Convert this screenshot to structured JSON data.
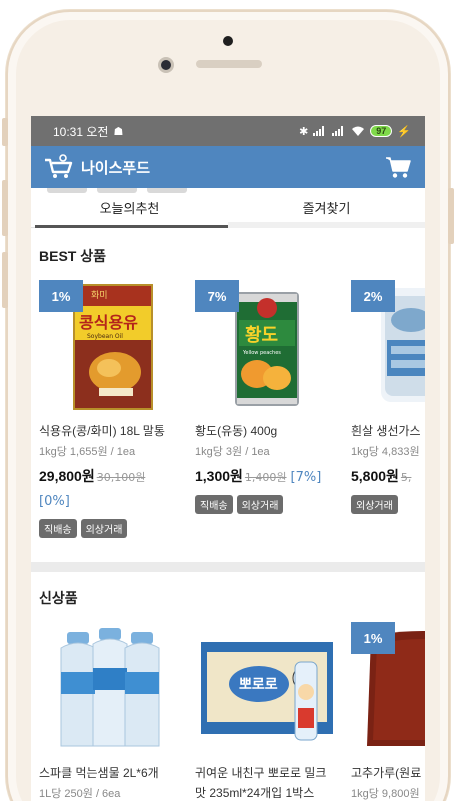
{
  "status_bar": {
    "time": "10:31 오전",
    "battery": "97"
  },
  "app": {
    "name": "나이스푸드"
  },
  "tabs": [
    {
      "label": "오늘의추천"
    },
    {
      "label": "즐겨찾기"
    }
  ],
  "sections": {
    "best": {
      "title": "BEST 상품",
      "products": [
        {
          "discount": "1%",
          "name": "식용유(콩/화미) 18L 말통",
          "unit": "1kg당 1,655원 / 1ea",
          "price": "29,800원",
          "original_price": "30,100원",
          "rate": "[0%]",
          "tags": [
            "직배송",
            "외상거래"
          ]
        },
        {
          "discount": "7%",
          "name": "황도(유동) 400g",
          "unit": "1kg당 3원 / 1ea",
          "price": "1,300원",
          "original_price": "1,400원",
          "rate": "[7%]",
          "tags": [
            "직배송",
            "외상거래"
          ]
        },
        {
          "discount": "2%",
          "name": "흰살 생선가스",
          "unit": "1kg당 4,833원",
          "price": "5,800원",
          "original_price": "5,",
          "rate": "",
          "tags": [
            "외상거래"
          ]
        }
      ]
    },
    "new": {
      "title": "신상품",
      "products": [
        {
          "discount": "",
          "name": "스파클 먹는샘물 2L*6개",
          "unit": "1L당 250원 / 6ea"
        },
        {
          "discount": "",
          "name": "귀여운 내친구 뽀로로 밀크",
          "name2": "맛 235ml*24개입 1박스",
          "unit": ""
        },
        {
          "discount": "1%",
          "name": "고추가루(원료",
          "unit": "1kg당 9,800원"
        }
      ]
    }
  },
  "product_image_text": {
    "oil_brand": "화미",
    "oil_label": "콩식용유",
    "oil_sub": "Soybean Oil",
    "peach_label": "황도",
    "peach_sub": "Yellow peaches",
    "pororo_label": "뽀로로"
  }
}
